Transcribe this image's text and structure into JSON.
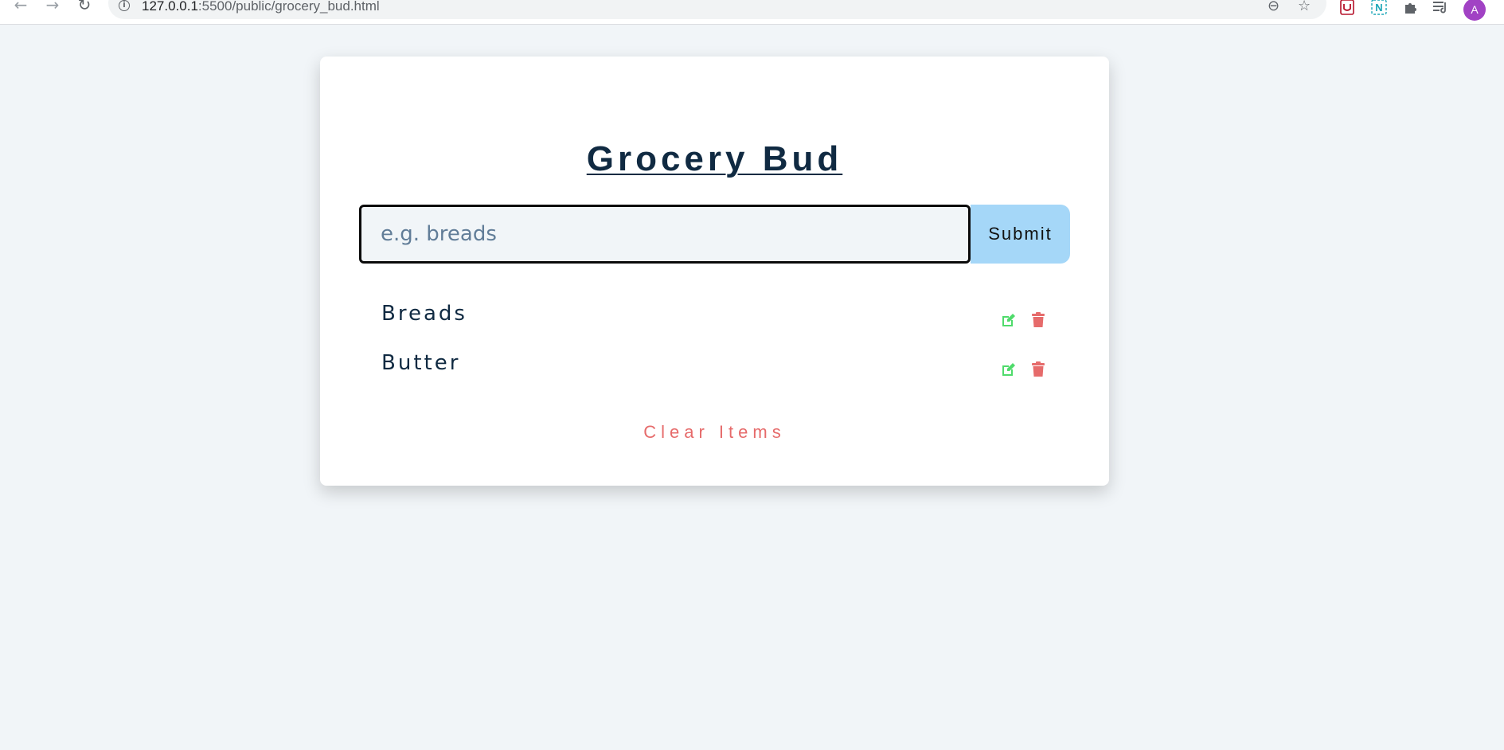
{
  "browser": {
    "url_host": "127.0.0.1",
    "url_path": ":5500/public/grocery_bud.html",
    "avatar_letter": "A"
  },
  "app": {
    "title": "Grocery Bud",
    "input_placeholder": "e.g. breads",
    "input_value": "",
    "submit_label": "Submit",
    "clear_label": "Clear Items",
    "items": [
      {
        "label": "Breads"
      },
      {
        "label": "Butter"
      }
    ]
  },
  "colors": {
    "background": "#f1f5f8",
    "title": "#102a42",
    "submit_bg": "#a5d7f8",
    "edit_icon": "#4fdb6b",
    "delete_icon": "#e66b6b",
    "clear_text": "#e66b6b"
  },
  "icons": {
    "edit": "edit-icon",
    "delete": "trash-icon"
  }
}
